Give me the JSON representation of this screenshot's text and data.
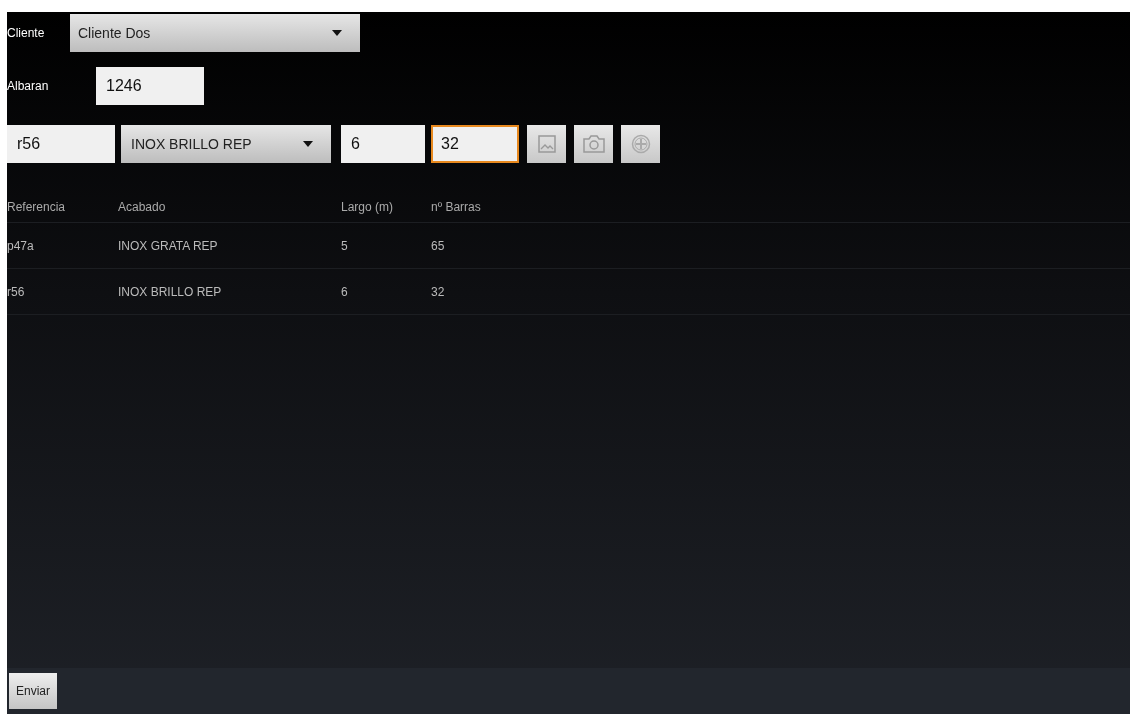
{
  "cliente": {
    "label": "Cliente",
    "value": "Cliente Dos"
  },
  "albaran": {
    "label": "Albaran",
    "value": "1246"
  },
  "entry": {
    "referencia": {
      "value": "r56",
      "focused": false
    },
    "acabado": {
      "value": "INOX BRILLO REP",
      "focused": false
    },
    "largo": {
      "value": "6",
      "focused": false
    },
    "barras": {
      "value": "32",
      "focused": true
    }
  },
  "table": {
    "columns": [
      "Referencia",
      "Acabado",
      "Largo (m)",
      "nº Barras"
    ],
    "rows": [
      [
        "p47a",
        "INOX GRATA REP",
        "5",
        "65"
      ],
      [
        "r56",
        "INOX BRILLO REP",
        "6",
        "32"
      ]
    ]
  },
  "send_button": "Enviar"
}
